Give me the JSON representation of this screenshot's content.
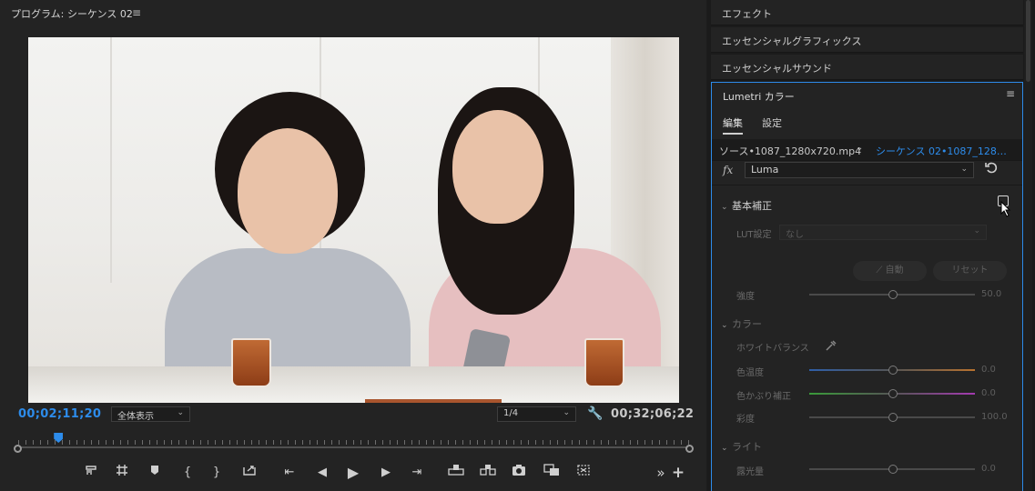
{
  "program_monitor": {
    "title": "プログラム: シーケンス 02",
    "menu_glyph": "≡",
    "timecode_current": "00;02;11;20",
    "timecode_duration": "00;32;06;22",
    "zoom_select": "全体表示",
    "resolution_select": "1/4",
    "playhead_position": 0.06,
    "transport_glyphs": {
      "add_marker": "▾",
      "mark_in": "{",
      "mark_out": "}",
      "go_to_in": "⇤",
      "step_back": "◀",
      "play": "▶",
      "step_forward": "▶",
      "go_to_out": "⇥",
      "more": "»",
      "add": "+"
    }
  },
  "right_panels": {
    "collapsed": [
      "エフェクト",
      "エッセンシャルグラフィックス",
      "エッセンシャルサウンド"
    ]
  },
  "lumetri": {
    "title": "Lumetri カラー",
    "menu_glyph": "≡",
    "tabs": [
      "編集",
      "設定"
    ],
    "active_tab": "編集",
    "source_clip": "ソース•1087_1280x720.mp4",
    "sequence_clip": "シーケンス 02•1087_128…",
    "fx_label": "fx",
    "effect_select": "Luma",
    "basic_section": {
      "title": "基本補正",
      "enabled": false,
      "lut_label": "LUT設定",
      "lut_value": "なし",
      "auto_button": "自動",
      "reset_button": "リセット",
      "intensity_label": "強度",
      "intensity_value": "50.0"
    },
    "color_section": {
      "title": "カラー",
      "white_balance_label": "ホワイトバランス",
      "temperature_label": "色温度",
      "temperature_value": "0.0",
      "tint_label": "色かぶり補正",
      "tint_value": "0.0",
      "saturation_label": "彩度",
      "saturation_value": "100.0"
    },
    "light_section": {
      "title": "ライト",
      "exposure_label": "露光量",
      "exposure_value": "0.0"
    }
  },
  "colors": {
    "accent": "#2d8ceb",
    "panel_bg": "#232323",
    "temp_low": "#2f5fa8",
    "temp_high": "#b8722f",
    "tint_low": "#3a9a3a",
    "tint_high": "#a33ab0"
  }
}
